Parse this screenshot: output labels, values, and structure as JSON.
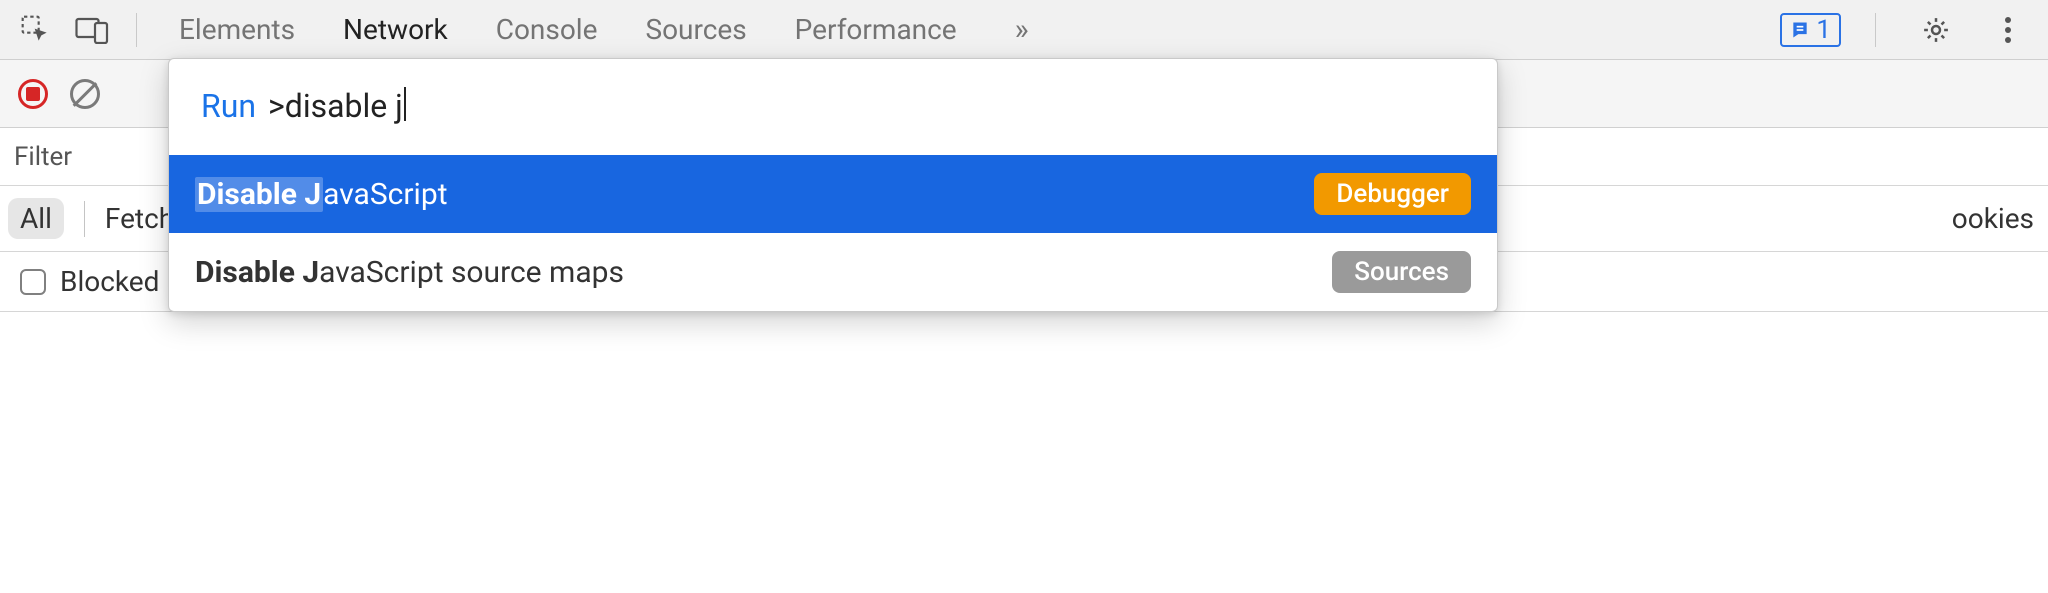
{
  "tabs": {
    "elements": "Elements",
    "network": "Network",
    "console": "Console",
    "sources": "Sources",
    "performance": "Performance",
    "overflow": "»"
  },
  "issues": {
    "count": "1"
  },
  "filter": {
    "label": "Filter"
  },
  "typefilters": {
    "all": "All",
    "fetch": "Fetch/",
    "cookies_trail": "ookies"
  },
  "blocked": {
    "label": "Blocked"
  },
  "palette": {
    "run_label": "Run",
    "query_prefix": ">",
    "query_text": "disable j",
    "result1": {
      "match": "Disable J",
      "rest": "avaScript",
      "source": "Debugger"
    },
    "result2": {
      "match": "Disable J",
      "rest": "avaScript source maps",
      "source": "Sources"
    }
  }
}
